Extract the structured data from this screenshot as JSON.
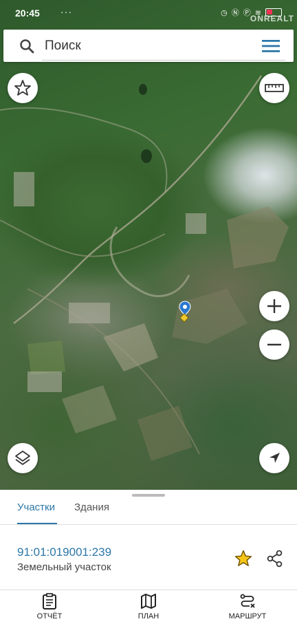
{
  "status_bar": {
    "time": "20:45",
    "dots": "···",
    "battery_level": 0.35,
    "watermark": "ONREALT"
  },
  "search": {
    "placeholder": "Поиск"
  },
  "map": {
    "controls": [
      "favorites-star",
      "ruler",
      "zoom-in",
      "zoom-out",
      "layers",
      "locate"
    ],
    "zoom_in_label": "+",
    "zoom_out_label": "−",
    "accent_color": "#2b78a8",
    "marker_color": "#f3c72b"
  },
  "tabs": {
    "active": "Участки",
    "inactive": "Здания"
  },
  "parcel": {
    "cadastral_number": "91:01:019001:239",
    "type": "Земельный участок"
  },
  "bottom_nav": {
    "report": "ОТЧЁТ",
    "plan": "ПЛАН",
    "route": "МАРШРУТ"
  }
}
